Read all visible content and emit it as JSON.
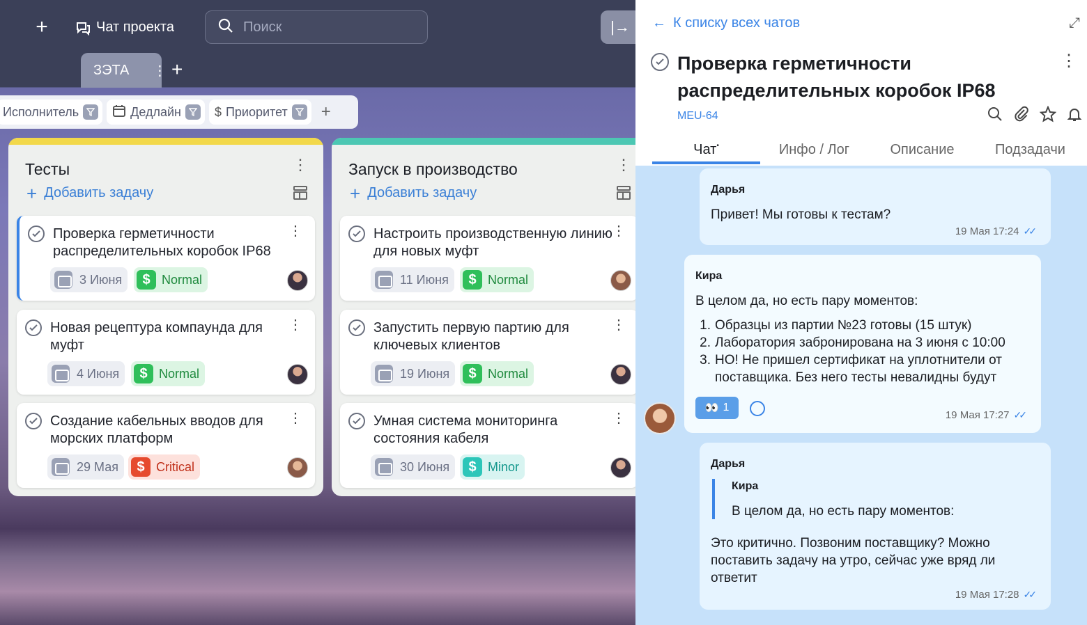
{
  "topbar": {
    "add_label": "+",
    "chat_label": "Чат проекта",
    "search_placeholder": "Поиск",
    "collapse_label": "|→"
  },
  "project_tab": {
    "name": "ЗЭТА",
    "menu": "⋮",
    "add": "+"
  },
  "filters": [
    {
      "label": "Исполнитель",
      "icon": "person-icon"
    },
    {
      "label": "Дедлайн",
      "icon": "calendar-icon"
    },
    {
      "label": "Приоритет",
      "icon": "dollar-icon"
    }
  ],
  "filters_add": "+",
  "columns": [
    {
      "title": "Тесты",
      "stripe_color": "#f2d84a",
      "add_label": "Добавить задачу",
      "cards": [
        {
          "title": "Проверка герметичности распределительных коробок IP68",
          "date": "3 Июня",
          "priority": "Normal",
          "priority_color": "#2fbf5a",
          "priority_bg": "#dcf5e3",
          "active": true
        },
        {
          "title": "Новая рецептура компаунда для муфт",
          "date": "4 Июня",
          "priority": "Normal",
          "priority_color": "#2fbf5a",
          "priority_bg": "#dcf5e3",
          "active": false
        },
        {
          "title": "Создание кабельных вводов для морских платформ",
          "date": "29 Мая",
          "priority": "Critical",
          "priority_color": "#e64a2e",
          "priority_bg": "#fde1dc",
          "active": false
        }
      ]
    },
    {
      "title": "Запуск в производство",
      "stripe_color": "#4cc7b3",
      "add_label": "Добавить задачу",
      "cards": [
        {
          "title": "Настроить производственную линию для новых муфт",
          "date": "11 Июня",
          "priority": "Normal",
          "priority_color": "#2fbf5a",
          "priority_bg": "#dcf5e3",
          "active": false
        },
        {
          "title": "Запустить первую партию для ключевых клиентов",
          "date": "19 Июня",
          "priority": "Normal",
          "priority_color": "#2fbf5a",
          "priority_bg": "#dcf5e3",
          "active": false
        },
        {
          "title": "Умная система мониторинга состояния кабеля",
          "date": "30 Июня",
          "priority": "Minor",
          "priority_color": "#2cc6b9",
          "priority_bg": "#d8f4f1",
          "active": false
        }
      ]
    }
  ],
  "chat": {
    "back_label": "К списку всех чатов",
    "task_title": "Проверка герметичности распределительных коробок IP68",
    "task_code": "MEU-64",
    "tabs": [
      "Чат",
      "Инфо / Лог",
      "Описание",
      "Подзадачи"
    ],
    "messages": [
      {
        "author": "Дарья",
        "text": "Привет! Мы готовы к тестам?",
        "time": "19 Мая 17:24"
      },
      {
        "author": "Кира",
        "intro": "В целом да, но есть пару моментов:",
        "items": [
          "Образцы из партии №23 готовы (15 штук)",
          "Лаборатория забронирована на 3 июня с 10:00",
          "НО! Не пришел сертификат на уплотнители от поставщика. Без него тесты невалидны будут"
        ],
        "reaction": "👀",
        "reaction_count": "1",
        "time": "19 Мая 17:27"
      },
      {
        "author": "Дарья",
        "quote_author": "Кира",
        "quote_text": "В целом да, но есть пару моментов:",
        "text": "Это критично. Позвоним поставщику? Можно поставить задачу на утро, сейчас уже вряд ли ответит",
        "time": "19 Мая 17:28"
      }
    ]
  }
}
